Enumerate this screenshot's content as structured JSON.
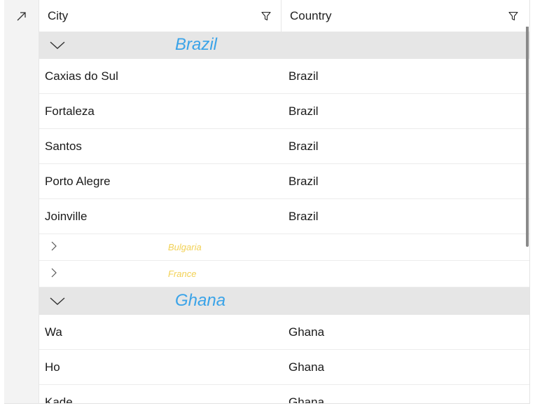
{
  "header": {
    "corner_icon": "expand-arrow-icon",
    "columns": [
      {
        "label": "City",
        "icon": "filter-icon"
      },
      {
        "label": "Country",
        "icon": "filter-icon"
      }
    ]
  },
  "groups": [
    {
      "title": "Brazil",
      "expanded": true,
      "rows": [
        {
          "city": "Caxias do Sul",
          "country": "Brazil"
        },
        {
          "city": "Fortaleza",
          "country": "Brazil"
        },
        {
          "city": "Santos",
          "country": "Brazil"
        },
        {
          "city": "Porto Alegre",
          "country": "Brazil"
        },
        {
          "city": "Joinville",
          "country": "Brazil"
        }
      ]
    },
    {
      "title": "Bulgaria",
      "expanded": false,
      "rows": []
    },
    {
      "title": "France",
      "expanded": false,
      "rows": []
    },
    {
      "title": "Ghana",
      "expanded": true,
      "rows": [
        {
          "city": "Wa",
          "country": "Ghana"
        },
        {
          "city": "Ho",
          "country": "Ghana"
        },
        {
          "city": "Kade",
          "country": "Ghana"
        }
      ]
    }
  ],
  "colors": {
    "expanded_group_title": "#3aa3e8",
    "collapsed_group_title": "#f2d155",
    "group_header_bg": "#e6e6e6"
  }
}
